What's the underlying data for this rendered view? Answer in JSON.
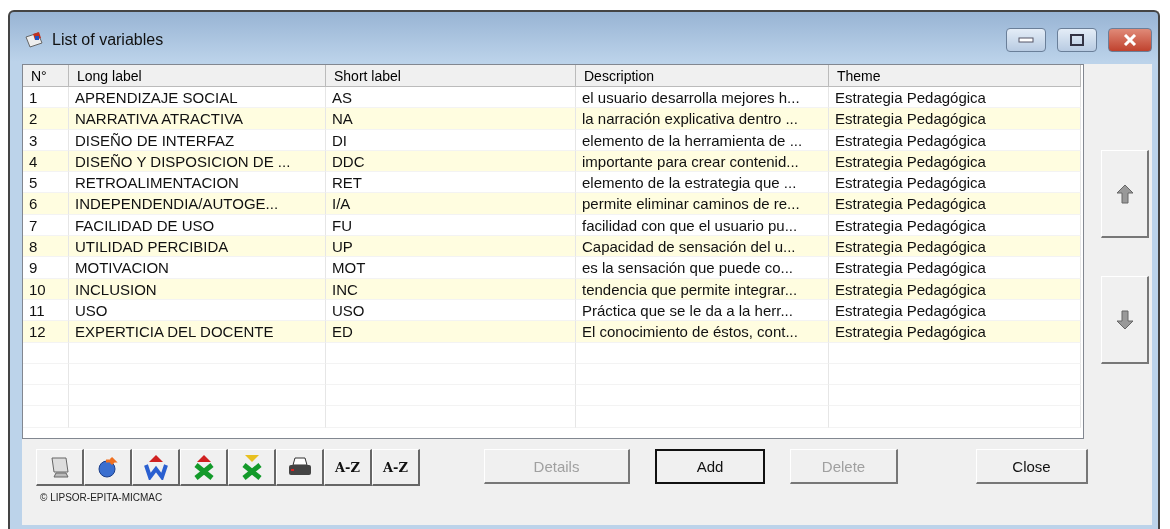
{
  "window": {
    "title": "List of variables"
  },
  "table": {
    "columns": [
      "N°",
      "Long label",
      "Short label",
      "Description",
      "Theme"
    ],
    "rows": [
      [
        "1",
        "APRENDIZAJE SOCIAL",
        "AS",
        "el usuario desarrolla mejores h...",
        "Estrategia Pedagógica"
      ],
      [
        "2",
        "NARRATIVA ATRACTIVA",
        "NA",
        "la narración explicativa dentro ...",
        "Estrategia Pedagógica"
      ],
      [
        "3",
        "DISEÑO DE INTERFAZ",
        "DI",
        "elemento de la herramienta de ...",
        "Estrategia Pedagógica"
      ],
      [
        "4",
        "DISEÑO Y DISPOSICION DE ...",
        "DDC",
        "importante para crear contenid...",
        "Estrategia Pedagógica"
      ],
      [
        "5",
        "RETROALIMENTACION",
        "RET",
        "elemento de la estrategia que ...",
        "Estrategia Pedagógica"
      ],
      [
        "6",
        "INDEPENDENDIA/AUTOGE...",
        "I/A",
        "permite eliminar caminos de re...",
        "Estrategia Pedagógica"
      ],
      [
        "7",
        "FACILIDAD DE USO",
        "FU",
        "facilidad con que el usuario pu...",
        "Estrategia Pedagógica"
      ],
      [
        "8",
        "UTILIDAD PERCIBIDA",
        "UP",
        "Capacidad de sensación del u...",
        "Estrategia Pedagógica"
      ],
      [
        "9",
        "MOTIVACION",
        "MOT",
        "es la sensación que puede co...",
        "Estrategia Pedagógica"
      ],
      [
        "10",
        "INCLUSION",
        "INC",
        "tendencia que permite integrar...",
        "Estrategia Pedagógica"
      ],
      [
        "11",
        "USO",
        "USO",
        "Práctica que se le da a la herr...",
        "Estrategia Pedagógica"
      ],
      [
        "12",
        "EXPERTICIA DEL DOCENTE",
        "ED",
        "El conocimiento de éstos, cont...",
        "Estrategia Pedagógica"
      ]
    ]
  },
  "toolbar": [
    {
      "kind": "monitor"
    },
    {
      "kind": "refresh"
    },
    {
      "kind": "w-up"
    },
    {
      "kind": "x-up"
    },
    {
      "kind": "x-down"
    },
    {
      "kind": "printer"
    },
    {
      "kind": "text",
      "label": "A-Z"
    },
    {
      "kind": "text",
      "label": "A-Z"
    }
  ],
  "buttons": [
    {
      "label": "Details",
      "disabled": true,
      "default": false
    },
    {
      "label": "Add",
      "disabled": false,
      "default": true
    },
    {
      "label": "Delete",
      "disabled": true,
      "default": false
    },
    {
      "label": "Close",
      "disabled": false,
      "default": false
    }
  ],
  "copyright": "© LIPSOR-EPITA-MICMAC"
}
